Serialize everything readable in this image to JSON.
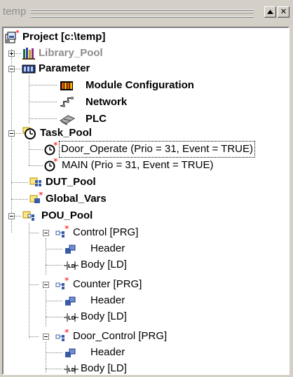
{
  "window": {
    "title": "temp"
  },
  "tree": {
    "root": "Project [c:\\temp]",
    "library_pool": "Library_Pool",
    "parameter": "Parameter",
    "module_configuration": "Module Configuration",
    "network": "Network",
    "plc": "PLC",
    "task_pool": "Task_Pool",
    "task_door_operate": "Door_Operate (Prio = 31, Event = TRUE)",
    "task_main": "MAIN (Prio = 31, Event = TRUE)",
    "dut_pool": "DUT_Pool",
    "global_vars": "Global_Vars",
    "pou_pool": "POU_Pool",
    "pous": [
      {
        "name": "Control [PRG]",
        "header": "Header",
        "body": "Body [LD]"
      },
      {
        "name": "Counter [PRG]",
        "header": "Header",
        "body": "Body [LD]"
      },
      {
        "name": "Door_Control [PRG]",
        "header": "Header",
        "body": "Body [LD]"
      }
    ]
  },
  "colors": {
    "window_bg": "#d4d0c8",
    "tree_bg": "#ffffff",
    "disabled_text": "#8c8c8c",
    "change_marker": "#ff0000"
  },
  "icons": {
    "project": "project-icon",
    "library": "library-icon",
    "parameter": "parameter-icon",
    "module": "module-icon",
    "network": "network-icon",
    "plc": "plc-icon",
    "task_pool": "clock-icon",
    "task": "task-icon",
    "dut": "dut-icon",
    "global_vars": "global-vars-icon",
    "pou_pool": "pou-pool-icon",
    "pou": "pou-icon",
    "header": "header-icon",
    "body": "ld-body-icon"
  }
}
